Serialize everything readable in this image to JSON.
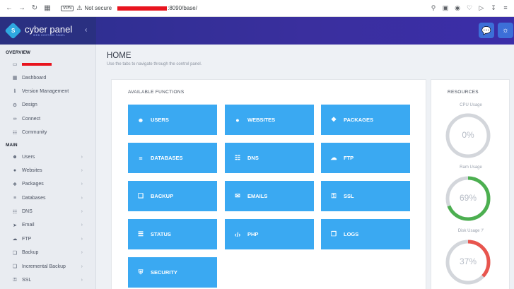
{
  "browser": {
    "vpn": "VPN",
    "security": "Not secure",
    "url_suffix": ":8090/base/"
  },
  "header": {
    "logo_text": "cyber panel",
    "logo_sub": "WEB HOSTING PANEL"
  },
  "sidebar": {
    "overview_title": "OVERVIEW",
    "overview_items": [
      {
        "label": "Dashboard",
        "icon": "dashboard-icon"
      },
      {
        "label": "Version Management",
        "icon": "info-icon"
      },
      {
        "label": "Design",
        "icon": "gear-icon"
      },
      {
        "label": "Connect",
        "icon": "link-icon"
      },
      {
        "label": "Community",
        "icon": "chat-icon"
      }
    ],
    "main_title": "MAIN",
    "main_items": [
      {
        "label": "Users",
        "icon": "users-icon"
      },
      {
        "label": "Websites",
        "icon": "globe-icon"
      },
      {
        "label": "Packages",
        "icon": "packages-icon"
      },
      {
        "label": "Databases",
        "icon": "database-icon"
      },
      {
        "label": "DNS",
        "icon": "sitemap-icon"
      },
      {
        "label": "Email",
        "icon": "paper-plane-icon"
      },
      {
        "label": "FTP",
        "icon": "cloud-upload-icon"
      },
      {
        "label": "Backup",
        "icon": "backup-icon"
      },
      {
        "label": "Incremental Backup",
        "icon": "backup-icon"
      },
      {
        "label": "SSL",
        "icon": "lock-icon"
      }
    ]
  },
  "main": {
    "title": "HOME",
    "subtitle": "Use the tabs to navigate through the control panel.",
    "functions_title": "AVAILABLE FUNCTIONS",
    "tiles": [
      {
        "label": "USERS",
        "icon": "users-icon"
      },
      {
        "label": "WEBSITES",
        "icon": "globe-icon"
      },
      {
        "label": "PACKAGES",
        "icon": "packages-icon"
      },
      {
        "label": "DATABASES",
        "icon": "database-icon"
      },
      {
        "label": "DNS",
        "icon": "sitemap-icon"
      },
      {
        "label": "FTP",
        "icon": "cloud-upload-icon"
      },
      {
        "label": "BACKUP",
        "icon": "backup-icon"
      },
      {
        "label": "EMAILS",
        "icon": "envelope-icon"
      },
      {
        "label": "SSL",
        "icon": "lock-icon"
      },
      {
        "label": "STATUS",
        "icon": "list-icon"
      },
      {
        "label": "PHP",
        "icon": "code-icon"
      },
      {
        "label": "LOGS",
        "icon": "file-icon"
      },
      {
        "label": "SECURITY",
        "icon": "shield-icon"
      }
    ]
  },
  "resources": {
    "title": "RESOURCES",
    "cpu": {
      "label": "CPU Usage",
      "value": "0%",
      "percent": 0,
      "color": "#4caf50"
    },
    "ram": {
      "label": "Ram Usage",
      "value": "69%",
      "percent": 69,
      "color": "#4caf50"
    },
    "disk": {
      "label": "Disk Usage '/'",
      "value": "37%",
      "percent": 37,
      "color": "#e8554e"
    }
  }
}
